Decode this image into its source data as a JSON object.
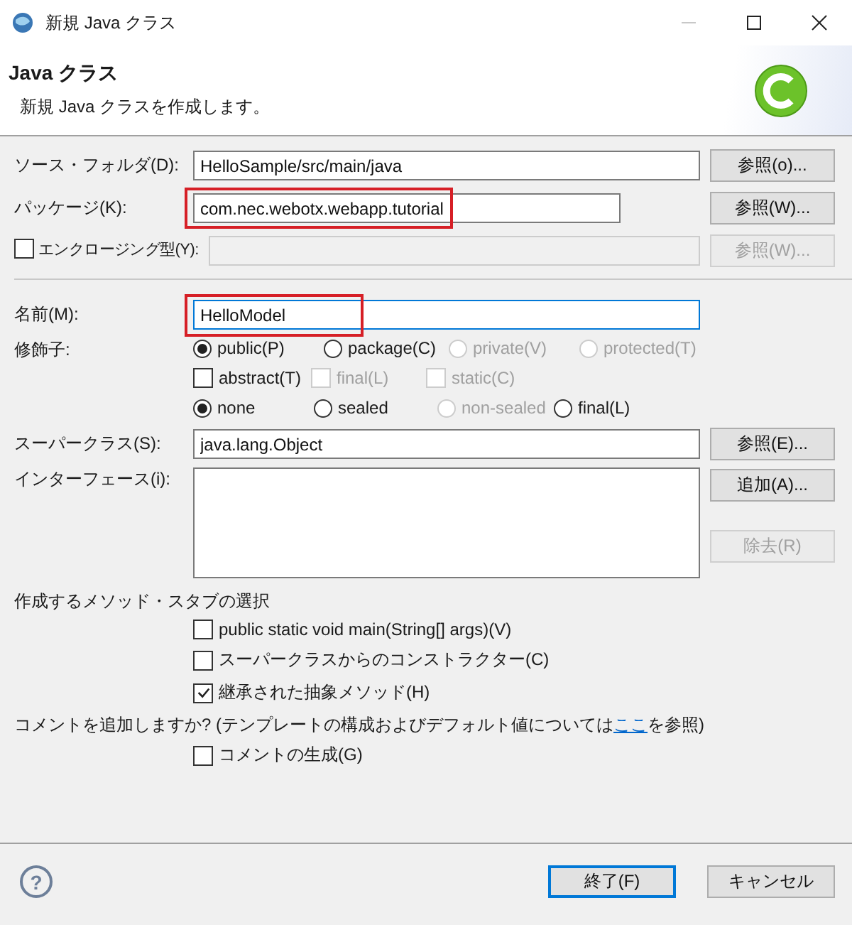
{
  "window": {
    "title": "新規 Java クラス",
    "minimize_disabled": true
  },
  "header": {
    "title": "Java クラス",
    "description": "新規 Java クラスを作成します。"
  },
  "source_folder": {
    "label": "ソース・フォルダ(D):",
    "value": "HelloSample/src/main/java",
    "button": "参照(o)...",
    "highlighted": false
  },
  "package": {
    "label": "パッケージ(K):",
    "value": "com.nec.webotx.webapp.tutorial",
    "button": "参照(W)...",
    "highlighted": true
  },
  "enclosing_type": {
    "label": "エンクロージング型(Y):",
    "checked": false,
    "disabled": true,
    "button": "参照(W)..."
  },
  "name": {
    "label": "名前(M):",
    "value": "HelloModel",
    "highlighted": true,
    "focused": true
  },
  "modifiers": {
    "label": "修飾子:",
    "access": [
      {
        "label": "public(P)",
        "selected": true,
        "disabled": false
      },
      {
        "label": "package(C)",
        "selected": false,
        "disabled": false
      },
      {
        "label": "private(V)",
        "selected": false,
        "disabled": true
      },
      {
        "label": "protected(T)",
        "selected": false,
        "disabled": true
      }
    ],
    "flags": [
      {
        "label": "abstract(T)",
        "checked": false,
        "disabled": false
      },
      {
        "label": "final(L)",
        "checked": false,
        "disabled": true
      },
      {
        "label": "static(C)",
        "checked": false,
        "disabled": true
      }
    ],
    "sealing": [
      {
        "label": "none",
        "selected": true,
        "disabled": false
      },
      {
        "label": "sealed",
        "selected": false,
        "disabled": false
      },
      {
        "label": "non-sealed",
        "selected": false,
        "disabled": true
      },
      {
        "label": "final(L)",
        "selected": false,
        "disabled": false
      }
    ]
  },
  "superclass": {
    "label": "スーパークラス(S):",
    "value": "java.lang.Object",
    "button": "参照(E)..."
  },
  "interfaces": {
    "label": "インターフェース(i):",
    "buttons": [
      {
        "label": "追加(A)...",
        "disabled": false
      },
      {
        "label": "除去(R)",
        "disabled": true
      }
    ]
  },
  "method_stubs": {
    "label": "作成するメソッド・スタブの選択",
    "options": [
      {
        "label": "public static void main(String[] args)(V)",
        "checked": false
      },
      {
        "label": "スーパークラスからのコンストラクター(C)",
        "checked": false
      },
      {
        "label": "継承された抽象メソッド(H)",
        "checked": true
      }
    ]
  },
  "comments": {
    "before": "コメントを追加しますか? (テンプレートの構成およびデフォルト値については",
    "link": "ここ",
    "after": "を参照)",
    "option": {
      "label": "コメントの生成(G)",
      "checked": false
    }
  },
  "help": {
    "glyph": "?"
  },
  "footer_buttons": [
    {
      "label": "終了(F)",
      "default": true
    },
    {
      "label": "キャンセル",
      "default": false
    }
  ]
}
